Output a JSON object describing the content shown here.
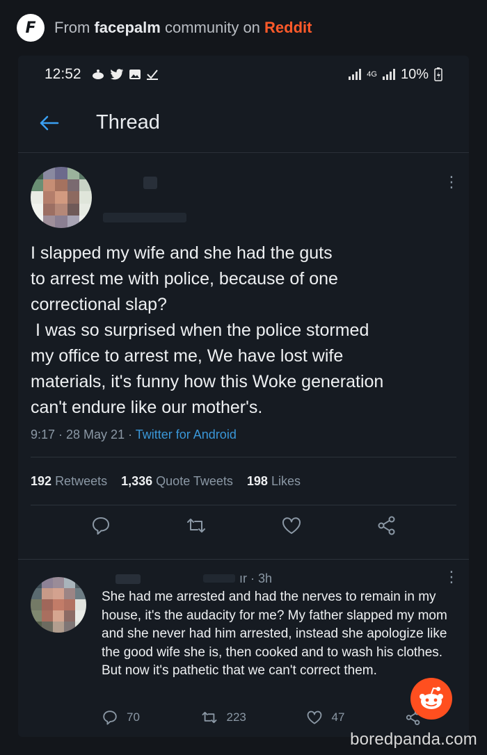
{
  "source_header": {
    "prefix": "From",
    "community": "facepalm",
    "mid": "community on",
    "site": "Reddit",
    "logo_letter": "F"
  },
  "status_bar": {
    "time": "12:52",
    "network": "4G",
    "battery": "10%"
  },
  "topbar": {
    "title": "Thread"
  },
  "tweet": {
    "text": "I slapped my wife and she had the guts\nto arrest me with police, because of one\ncorrectional slap?\n I was so surprised when the police stormed\nmy office to arrest me, We have lost wife\nmaterials, it's funny how this Woke generation\ncan't endure like our mother's.",
    "time": "9:17 · 28 May 21 ·",
    "source": "Twitter for Android",
    "retweets_count": "192",
    "retweets_label": "Retweets",
    "quotes_count": "1,336",
    "quotes_label": "Quote Tweets",
    "likes_count": "198",
    "likes_label": "Likes"
  },
  "reply": {
    "meta": "ır · 3h",
    "text": "She had me arrested and had the nerves to remain in my house, it's the audacity for me? My father slapped my mom and she never had him arrested, instead she apologize like the good wife she is, then cooked and to wash his clothes. But now it's pathetic that we can't correct them.",
    "replies": "70",
    "retweets": "223",
    "likes": "47"
  },
  "watermark": "boredpanda.com",
  "colors": {
    "accent_blue": "#3aa0f2",
    "reddit_orange": "#ff4f1f",
    "background": "#13161b"
  }
}
